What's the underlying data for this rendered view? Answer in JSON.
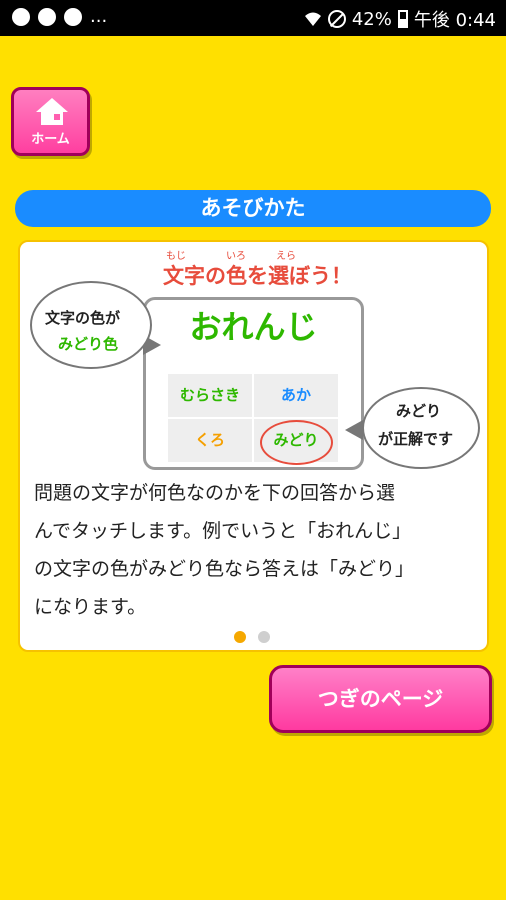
{
  "status_bar": {
    "battery_percent": "42%",
    "clock": "午後 0:44",
    "more": "..."
  },
  "home_button": {
    "label": "ホーム"
  },
  "title_bar": {
    "title": "あそびかた"
  },
  "card": {
    "heading": "文字の色を選ぼう！",
    "heading_ruby": [
      "もじ",
      "いろ",
      "えら"
    ],
    "example_word": "おれんじ",
    "example_word_color": "#2eb800",
    "answers": [
      {
        "label": "むらさき",
        "color": "#2eb800"
      },
      {
        "label": "あか",
        "color": "#1a8cff"
      },
      {
        "label": "くろ",
        "color": "#f5a000"
      },
      {
        "label": "みどり",
        "color": "#2eb800"
      }
    ],
    "bubble_left": {
      "line1": "文字の色が",
      "line2": "みどり色"
    },
    "bubble_right": {
      "line1": "みどり",
      "line2": "が正解です"
    },
    "description": [
      "問題の文字が何色なのかを下の回答から選",
      "んでタッチします。例でいうと「おれんじ」",
      "の文字の色がみどり色なら答えは「みどり」",
      "になります。"
    ],
    "page_dots": {
      "current": 1,
      "total": 2
    }
  },
  "next_button": {
    "label": "つぎのページ"
  },
  "colors": {
    "background": "#ffe000",
    "accent_blue": "#1a8cff",
    "accent_pink": "#ff3aa0",
    "heading_red": "#e74c3c"
  }
}
